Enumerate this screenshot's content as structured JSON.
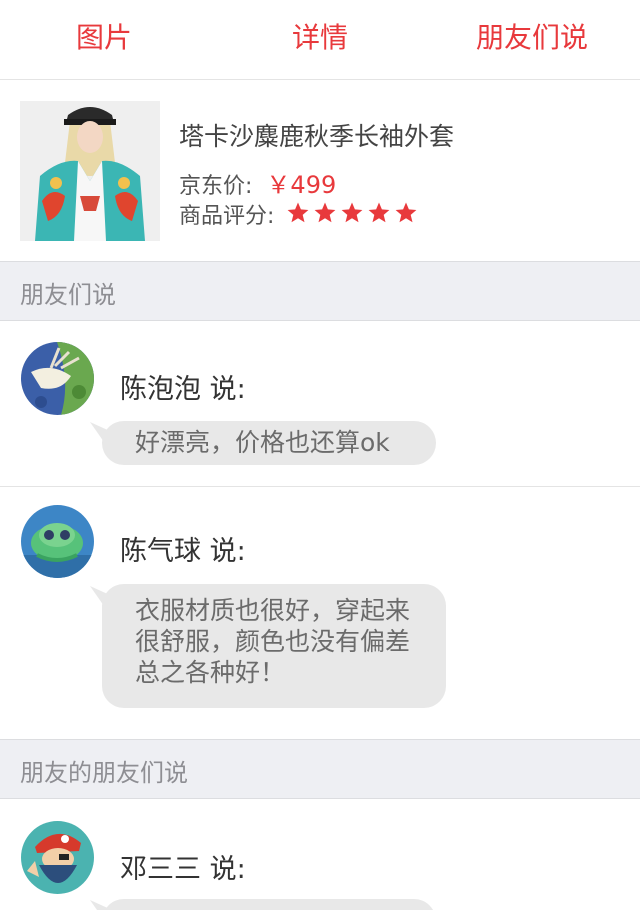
{
  "tabs": [
    {
      "label": "图片"
    },
    {
      "label": "详情"
    },
    {
      "label": "朋友们说"
    }
  ],
  "product": {
    "name": "塔卡沙麋鹿秋季长袖外套",
    "price_label": "京东价:",
    "price": "￥499",
    "rating_label": "商品评分:",
    "rating": 5,
    "rating_max": 5,
    "star_color": "#e8393c"
  },
  "sections": [
    {
      "title": "朋友们说",
      "comments": [
        {
          "author": "陈泡泡",
          "says": "说:",
          "lines": [
            "好漂亮，价格也还算ok"
          ]
        },
        {
          "author": "陈气球",
          "says": "说:",
          "lines": [
            "衣服材质也很好，穿起来",
            "很舒服，颜色也没有偏差",
            "总之各种好！"
          ]
        }
      ]
    },
    {
      "title": "朋友的朋友们说",
      "comments": [
        {
          "author": "邓三三",
          "says": "说:",
          "lines": []
        }
      ]
    }
  ],
  "accent_color": "#e8393c"
}
